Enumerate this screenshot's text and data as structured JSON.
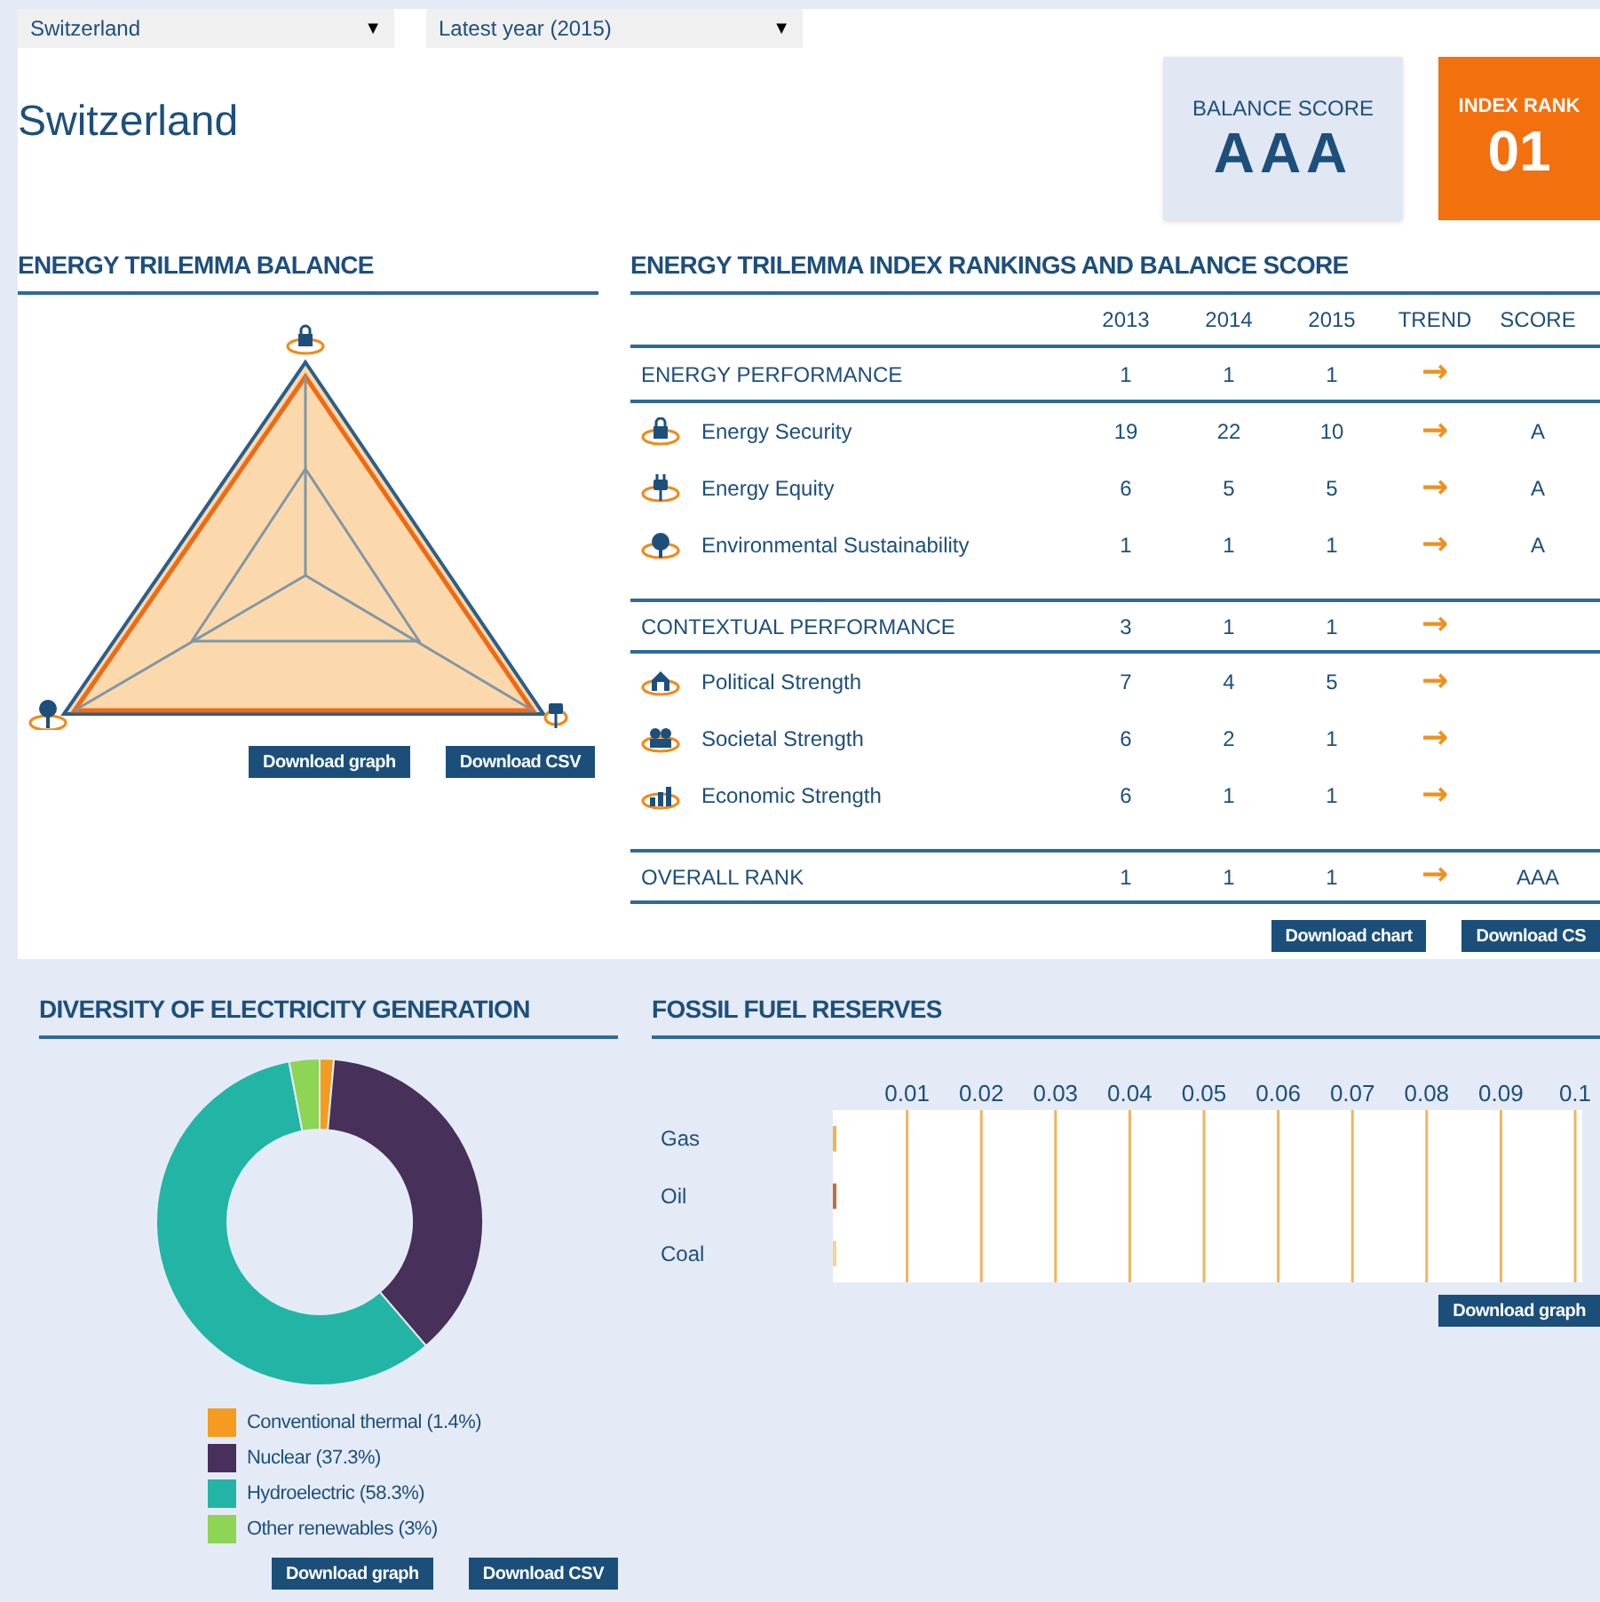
{
  "filters": [
    {
      "value": "Switzerland",
      "caret": "▼"
    },
    {
      "value": "Latest year (2015)",
      "caret": "▼"
    }
  ],
  "country": "Switzerland",
  "balance_score": {
    "label": "BALANCE SCORE",
    "value": "AAA"
  },
  "index_rank": {
    "label": "INDEX RANK",
    "value": "01"
  },
  "trilemma_balance": {
    "title": "ENERGY TRILEMMA BALANCE",
    "buttons": [
      "Download graph",
      "Download CSV"
    ]
  },
  "rankings": {
    "title": "ENERGY TRILEMMA INDEX RANKINGS AND BALANCE SCORE",
    "columns": [
      "2013",
      "2014",
      "2015",
      "TREND",
      "SCORE"
    ],
    "rows": [
      {
        "kind": "group",
        "name": "ENERGY PERFORMANCE",
        "values": [
          "1",
          "1",
          "1"
        ],
        "trend": "→",
        "score": ""
      },
      {
        "kind": "item",
        "name": "Energy Security",
        "values": [
          "19",
          "22",
          "10"
        ],
        "trend": "→",
        "score": "A"
      },
      {
        "kind": "item",
        "name": "Energy Equity",
        "values": [
          "6",
          "5",
          "5"
        ],
        "trend": "→",
        "score": "A"
      },
      {
        "kind": "item",
        "name": "Environmental Sustainability",
        "values": [
          "1",
          "1",
          "1"
        ],
        "trend": "→",
        "score": "A"
      },
      {
        "kind": "group",
        "name": "CONTEXTUAL PERFORMANCE",
        "values": [
          "3",
          "1",
          "1"
        ],
        "trend": "→",
        "score": ""
      },
      {
        "kind": "item",
        "name": "Political Strength",
        "values": [
          "7",
          "4",
          "5"
        ],
        "trend": "→",
        "score": ""
      },
      {
        "kind": "item",
        "name": "Societal Strength",
        "values": [
          "6",
          "2",
          "1"
        ],
        "trend": "→",
        "score": ""
      },
      {
        "kind": "item",
        "name": "Economic Strength",
        "values": [
          "6",
          "1",
          "1"
        ],
        "trend": "→",
        "score": ""
      },
      {
        "kind": "group",
        "name": "OVERALL RANK",
        "values": [
          "1",
          "1",
          "1"
        ],
        "trend": "→",
        "score": "AAA"
      }
    ],
    "buttons": [
      "Download chart",
      "Download CS"
    ]
  },
  "diversity": {
    "title": "DIVERSITY OF ELECTRICITY GENERATION",
    "chart_data": {
      "type": "donut",
      "categories": [
        "Conventional thermal (1.4%)",
        "Nuclear (37.3%)",
        "Hydroelectric (58.3%)",
        "Other renewables (3%)"
      ],
      "values": [
        1.4,
        37.3,
        58.3,
        3
      ],
      "legend": "bottom"
    },
    "legend": [
      {
        "color": "#f39c1f"
      },
      {
        "color": "#47305a"
      },
      {
        "color": "#22b5a6"
      },
      {
        "color": "#8ed455"
      }
    ],
    "buttons": [
      "Download graph",
      "Download CSV"
    ]
  },
  "fossil": {
    "title": "FOSSIL FUEL RESERVES",
    "chart_data": {
      "type": "bar",
      "orientation": "horizontal",
      "categories": [
        "Gas",
        "Oil",
        "Coal"
      ],
      "values": [
        0,
        0,
        0
      ],
      "grid": true,
      "xlim": [
        0,
        0.1
      ],
      "xticks": [
        0.01,
        0.02,
        0.03,
        0.04,
        0.05,
        0.06,
        0.07,
        0.08,
        0.09,
        {
          "value": 0.1,
          "label": "0.1"
        }
      ]
    },
    "bars": [
      {
        "color": "#f0b24a"
      },
      {
        "color": "#c0703a"
      },
      {
        "color": "#f5d690"
      }
    ],
    "buttons": [
      "Download graph"
    ]
  }
}
